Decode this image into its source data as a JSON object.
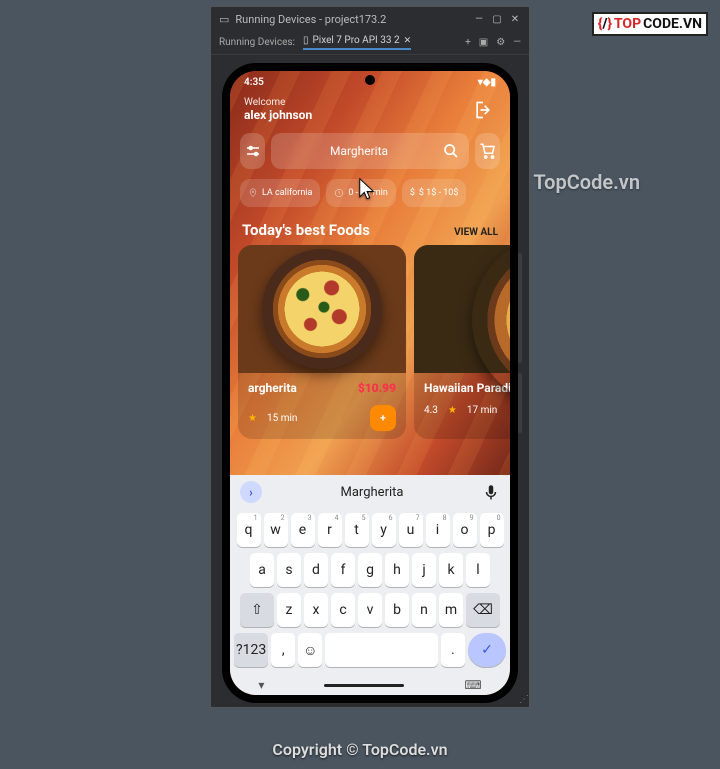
{
  "watermark": {
    "logo_red": "TOP",
    "logo_blk": "CODE.VN",
    "mid": "TopCode.vn",
    "foot": "Copyright © TopCode.vn"
  },
  "ide": {
    "title": "Running Devices - project173.2",
    "tabs_label": "Running Devices:",
    "tab_device": "Pixel 7 Pro API 33 2"
  },
  "statusbar": {
    "time": "4:35"
  },
  "header": {
    "welcome": "Welcome",
    "username": "alex johnson"
  },
  "search": {
    "value": "Margherita"
  },
  "chips": {
    "location": "LA california",
    "time": "0 - 10 min",
    "price": "$ 1$ - 10$"
  },
  "section": {
    "title": "Today's best Foods",
    "viewall": "VIEW ALL"
  },
  "cards": [
    {
      "name": "argherita",
      "price": "$10.99",
      "rating": "",
      "time": "15 min"
    },
    {
      "name": "Hawaiian Paradise",
      "price": "",
      "rating": "4.3",
      "time": "17 min"
    }
  ],
  "keyboard": {
    "suggestion": "Margherita",
    "row1": [
      "q",
      "w",
      "e",
      "r",
      "t",
      "y",
      "u",
      "i",
      "o",
      "p"
    ],
    "row1_sup": [
      "1",
      "2",
      "3",
      "4",
      "5",
      "6",
      "7",
      "8",
      "9",
      "0"
    ],
    "row2": [
      "a",
      "s",
      "d",
      "f",
      "g",
      "h",
      "j",
      "k",
      "l"
    ],
    "row3": [
      "z",
      "x",
      "c",
      "v",
      "b",
      "n",
      "m"
    ],
    "symkey": "?123",
    "comma": ",",
    "period": "."
  }
}
